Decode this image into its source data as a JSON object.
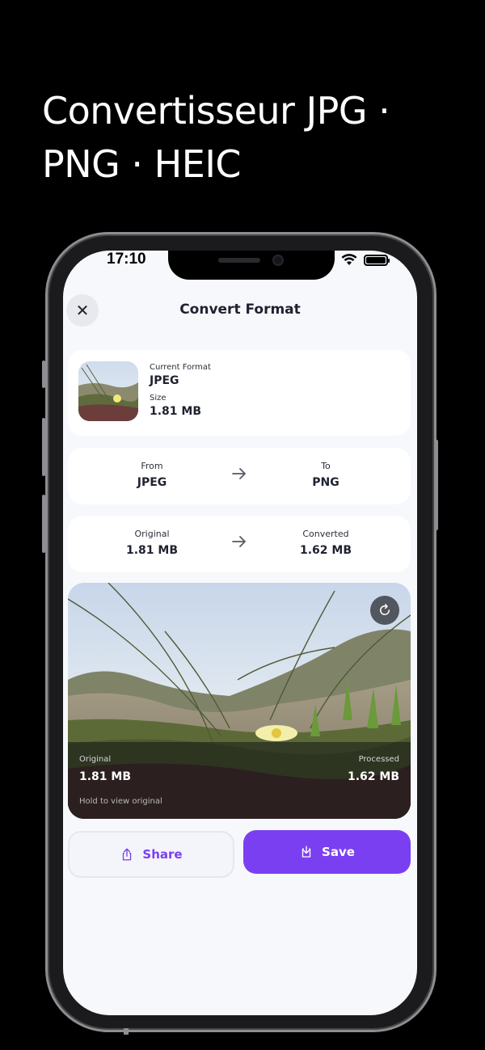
{
  "headline": {
    "line1": "Convertisseur JPG ·",
    "line2": "PNG · HEIC"
  },
  "status_bar": {
    "time": "17:10"
  },
  "header": {
    "title": "Convert Format",
    "close_icon": "close-icon"
  },
  "info_card": {
    "format_label": "Current Format",
    "format_value": "JPEG",
    "size_label": "Size",
    "size_value": "1.81 MB"
  },
  "format_row": {
    "from_label": "From",
    "from_value": "JPEG",
    "to_label": "To",
    "to_value": "PNG",
    "icon": "arrow-right-icon"
  },
  "size_row": {
    "original_label": "Original",
    "original_value": "1.81 MB",
    "converted_label": "Converted",
    "converted_value": "1.62 MB",
    "icon": "arrow-right-icon"
  },
  "preview": {
    "original_label": "Original",
    "original_value": "1.81 MB",
    "processed_label": "Processed",
    "processed_value": "1.62 MB",
    "hint": "Hold to view original",
    "refresh_icon": "refresh-icon"
  },
  "actions": {
    "share_label": "Share",
    "save_label": "Save",
    "accent": "#7b3ff2"
  }
}
